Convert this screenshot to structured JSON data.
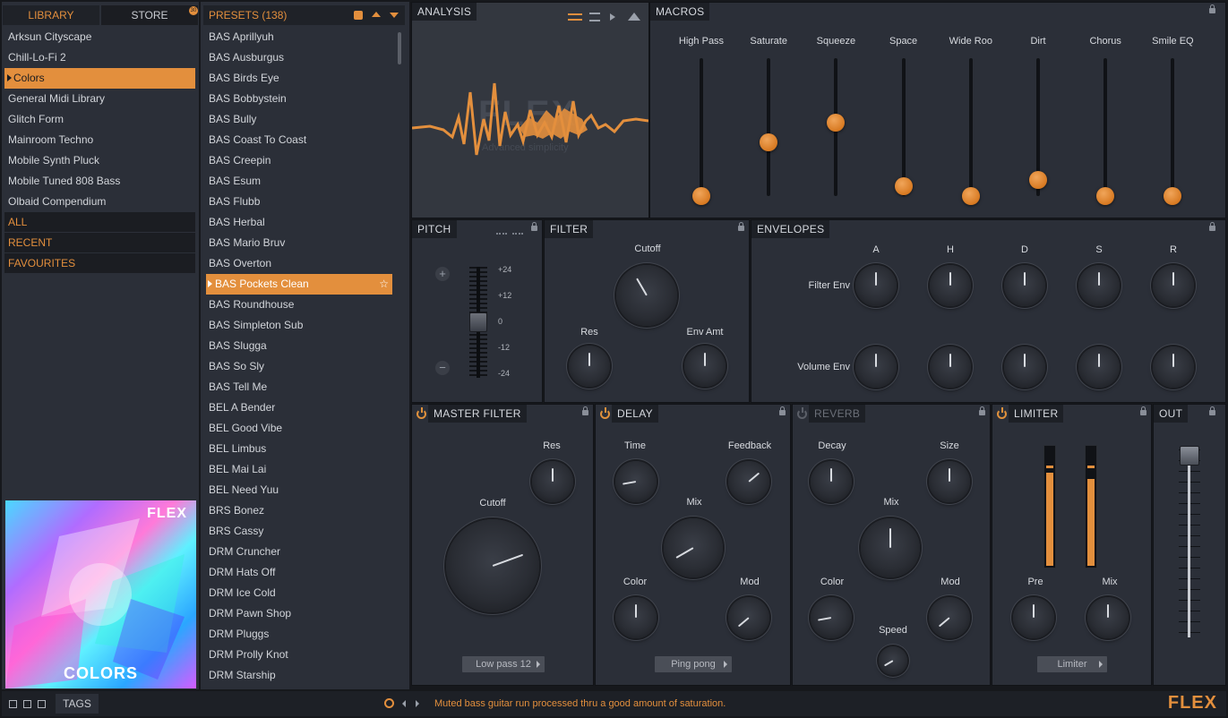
{
  "colors": {
    "accent": "#e38f3d"
  },
  "left": {
    "tabs": {
      "library": "LIBRARY",
      "store": "STORE",
      "store_badge": "30"
    },
    "libraries": [
      "Arksun Cityscape",
      "Chill-Lo-Fi 2",
      "Colors",
      "General Midi Library",
      "Glitch Form",
      "Mainroom Techno",
      "Mobile Synth Pluck",
      "Mobile Tuned 808 Bass",
      "Olbaid Compendium"
    ],
    "selected_library": 2,
    "sections": [
      "ALL",
      "RECENT",
      "FAVOURITES"
    ],
    "cover": {
      "brand": "FLEX",
      "title": "COLORS"
    },
    "tags_label": "TAGS"
  },
  "presets": {
    "title": "PRESETS (138)",
    "selected_index": 12,
    "items": [
      "BAS Aprillyuh",
      "BAS Ausburgus",
      "BAS Birds Eye",
      "BAS Bobbystein",
      "BAS Bully",
      "BAS Coast To Coast",
      "BAS Creepin",
      "BAS Esum",
      "BAS Flubb",
      "BAS Herbal",
      "BAS Mario Bruv",
      "BAS Overton",
      "BAS Pockets Clean",
      "BAS Roundhouse",
      "BAS Simpleton Sub",
      "BAS Slugga",
      "BAS So Sly",
      "BAS Tell Me",
      "BEL A Bender",
      "BEL Good Vibe",
      "BEL Limbus",
      "BEL Mai Lai",
      "BEL Need Yuu",
      "BRS Bonez",
      "BRS Cassy",
      "DRM Cruncher",
      "DRM Hats Off",
      "DRM Ice Cold",
      "DRM Pawn Shop",
      "DRM Pluggs",
      "DRM Prolly Knot",
      "DRM Starship"
    ]
  },
  "analysis": {
    "title": "ANALYSIS",
    "watermark": "FLEX",
    "watermark_sub": "Advanced simplicity"
  },
  "macros": {
    "title": "MACROS",
    "items": [
      {
        "label": "High Pass",
        "value": 0.0
      },
      {
        "label": "Saturate",
        "value": 0.39
      },
      {
        "label": "Squeeze",
        "value": 0.53
      },
      {
        "label": "Space",
        "value": 0.07
      },
      {
        "label": "Wide Roo",
        "value": 0.0
      },
      {
        "label": "Dirt",
        "value": 0.12
      },
      {
        "label": "Chorus",
        "value": 0.0
      },
      {
        "label": "Smile EQ",
        "value": 0.0
      }
    ]
  },
  "pitch": {
    "title": "PITCH",
    "ticks": [
      "+24",
      "+12",
      "0",
      "-12",
      "-24"
    ],
    "plus": "+",
    "minus": "−",
    "value": 0
  },
  "filter": {
    "title": "FILTER",
    "cutoff": "Cutoff",
    "res": "Res",
    "env_amt": "Env Amt"
  },
  "envelopes": {
    "title": "ENVELOPES",
    "cols": [
      "A",
      "H",
      "D",
      "S",
      "R"
    ],
    "rows": [
      "Filter Env",
      "Volume Env"
    ]
  },
  "master_filter": {
    "title": "MASTER FILTER",
    "res": "Res",
    "cutoff": "Cutoff",
    "mode": "Low pass 12"
  },
  "delay": {
    "title": "DELAY",
    "time": "Time",
    "feedback": "Feedback",
    "mix": "Mix",
    "color": "Color",
    "mod": "Mod",
    "mode": "Ping pong"
  },
  "reverb": {
    "title": "REVERB",
    "decay": "Decay",
    "size": "Size",
    "mix": "Mix",
    "color": "Color",
    "mod": "Mod",
    "speed": "Speed"
  },
  "limiter": {
    "title": "LIMITER",
    "pre": "Pre",
    "mix": "Mix",
    "mode": "Limiter",
    "meter_levels": [
      0.8,
      0.75
    ]
  },
  "out": {
    "title": "OUT"
  },
  "status": {
    "text": "Muted bass guitar run processed thru a good amount of saturation.",
    "logo": "FLEX"
  }
}
